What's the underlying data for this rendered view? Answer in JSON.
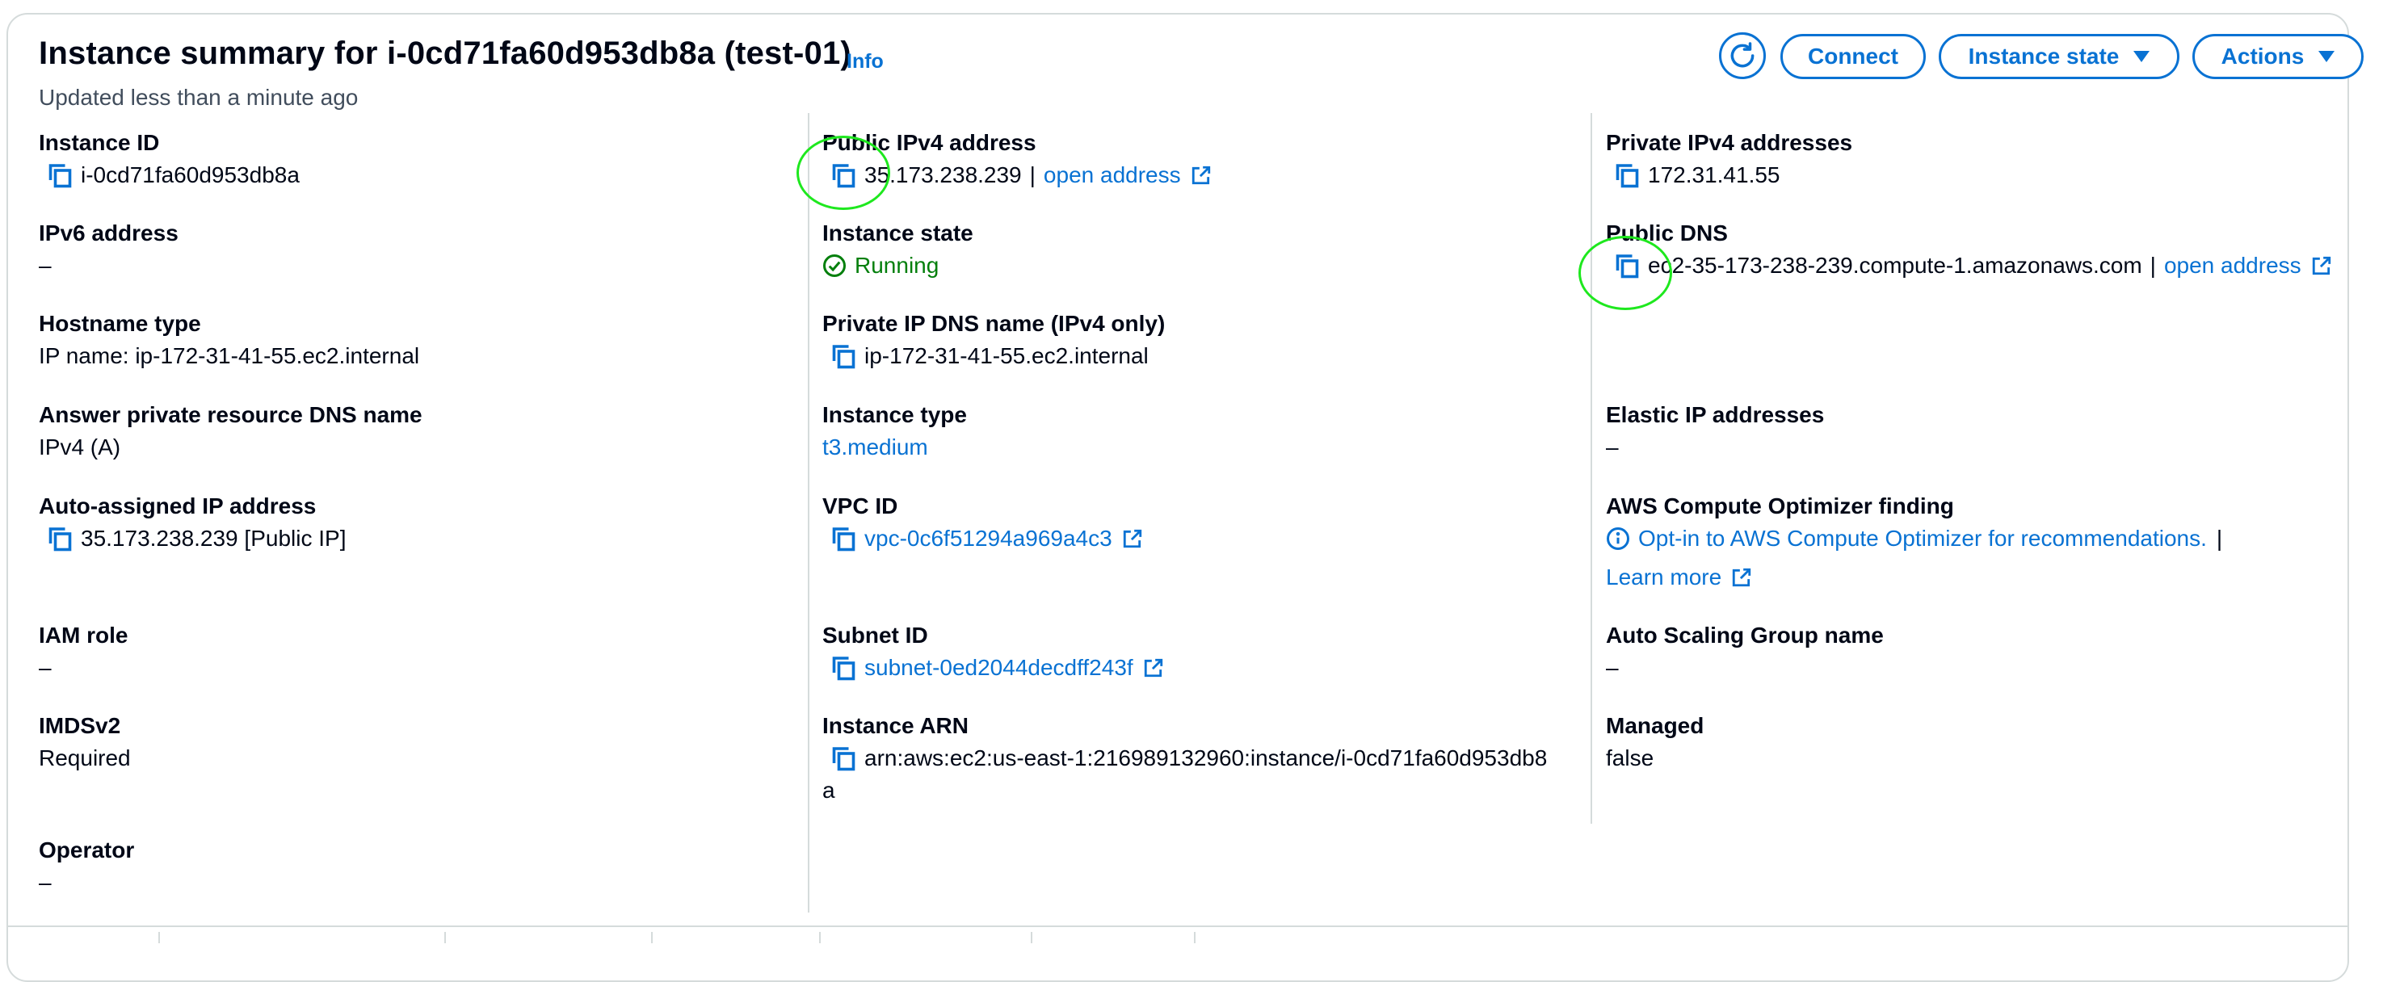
{
  "header": {
    "title": "Instance summary for i-0cd71fa60d953db8a (test-01)",
    "info_label": "Info",
    "updated": "Updated less than a minute ago"
  },
  "buttons": {
    "connect": "Connect",
    "instance_state": "Instance state",
    "actions": "Actions"
  },
  "col1": {
    "instance_id": {
      "label": "Instance ID",
      "value": "i-0cd71fa60d953db8a"
    },
    "ipv6": {
      "label": "IPv6 address",
      "value": "–"
    },
    "hostname_type": {
      "label": "Hostname type",
      "value": "IP name: ip-172-31-41-55.ec2.internal"
    },
    "answer_dns": {
      "label": "Answer private resource DNS name",
      "value": "IPv4 (A)"
    },
    "auto_ip": {
      "label": "Auto-assigned IP address",
      "value": "35.173.238.239 [Public IP]"
    },
    "iam_role": {
      "label": "IAM role",
      "value": "–"
    },
    "imdsv2": {
      "label": "IMDSv2",
      "value": "Required"
    },
    "operator": {
      "label": "Operator",
      "value": "–"
    }
  },
  "col2": {
    "public_ipv4": {
      "label": "Public IPv4 address",
      "value": "35.173.238.239",
      "sep": "|",
      "link": "open address"
    },
    "instance_state": {
      "label": "Instance state",
      "value": "Running"
    },
    "private_dns": {
      "label": "Private IP DNS name (IPv4 only)",
      "value": "ip-172-31-41-55.ec2.internal"
    },
    "instance_type": {
      "label": "Instance type",
      "value": "t3.medium"
    },
    "vpc_id": {
      "label": "VPC ID",
      "value": "vpc-0c6f51294a969a4c3"
    },
    "subnet_id": {
      "label": "Subnet ID",
      "value": "subnet-0ed2044decdff243f"
    },
    "instance_arn": {
      "label": "Instance ARN",
      "value_line1": "arn:aws:ec2:us-east-1:216989132960:instance/i-0cd71fa60d953db8",
      "value_line2": "a"
    }
  },
  "col3": {
    "private_ipv4": {
      "label": "Private IPv4 addresses",
      "value": "172.31.41.55"
    },
    "public_dns": {
      "label": "Public DNS",
      "value": "ec2-35-173-238-239.compute-1.amazonaws.com",
      "sep": "|",
      "link": "open address"
    },
    "elastic_ip": {
      "label": "Elastic IP addresses",
      "value": "–"
    },
    "optimizer": {
      "label": "AWS Compute Optimizer finding",
      "link": "Opt-in to AWS Compute Optimizer for recommendations.",
      "sep": "|",
      "learn_more": "Learn more"
    },
    "asg_name": {
      "label": "Auto Scaling Group name",
      "value": "–"
    },
    "managed": {
      "label": "Managed",
      "value": "false"
    }
  },
  "colors": {
    "link": "#0972d3",
    "success": "#037f0c",
    "border": "#d5dbdb",
    "highlight": "#1ee81e"
  }
}
